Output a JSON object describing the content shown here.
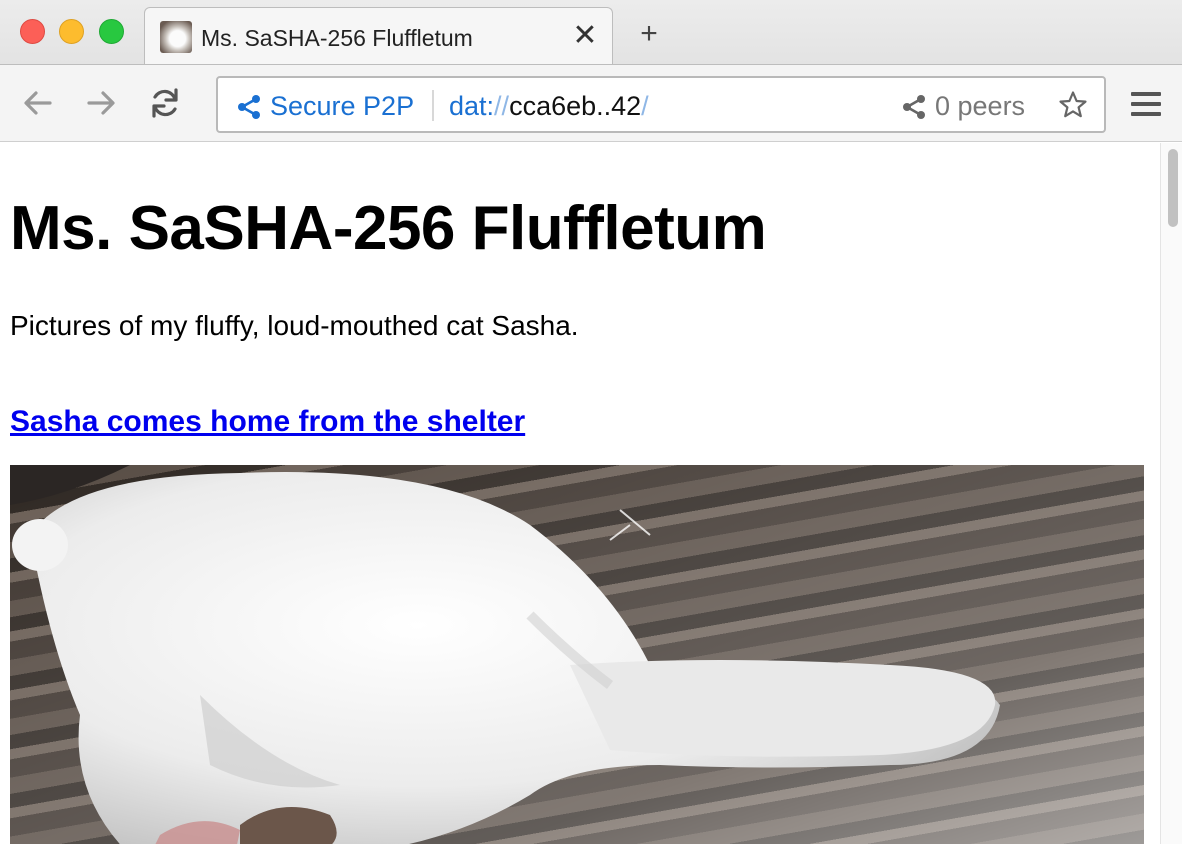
{
  "window": {
    "traffic_lights": [
      "close",
      "minimize",
      "zoom"
    ]
  },
  "tabs": [
    {
      "title": "Ms. SaSHA-256 Fluffletum",
      "active": true,
      "favicon": "cat-photo"
    }
  ],
  "tab_controls": {
    "close_glyph": "✕",
    "new_tab_glyph": "+"
  },
  "toolbar": {
    "back_icon": "arrow-left-icon",
    "forward_icon": "arrow-right-icon",
    "reload_icon": "reload-icon",
    "menu_icon": "hamburger-menu-icon"
  },
  "address_bar": {
    "security_label": "Secure P2P",
    "url_scheme": "dat:",
    "url_slashes": "//",
    "url_host": "cca6eb..42",
    "url_trailing": "/",
    "peers_label": "0 peers",
    "bookmark_icon": "star-icon"
  },
  "page": {
    "title": "Ms. SaSHA-256 Fluffletum",
    "description": "Pictures of my fluffy, loud-mouthed cat Sasha.",
    "posts": [
      {
        "link_text": "Sasha comes home from the shelter",
        "image": "white-fluffy-cat-on-wood-floor"
      }
    ]
  },
  "colors": {
    "accent_blue": "#1a70d2",
    "link_blue": "#0000ee",
    "close_red": "#fc5f57",
    "minimize_yellow": "#fdbc2e",
    "zoom_green": "#28c840"
  }
}
